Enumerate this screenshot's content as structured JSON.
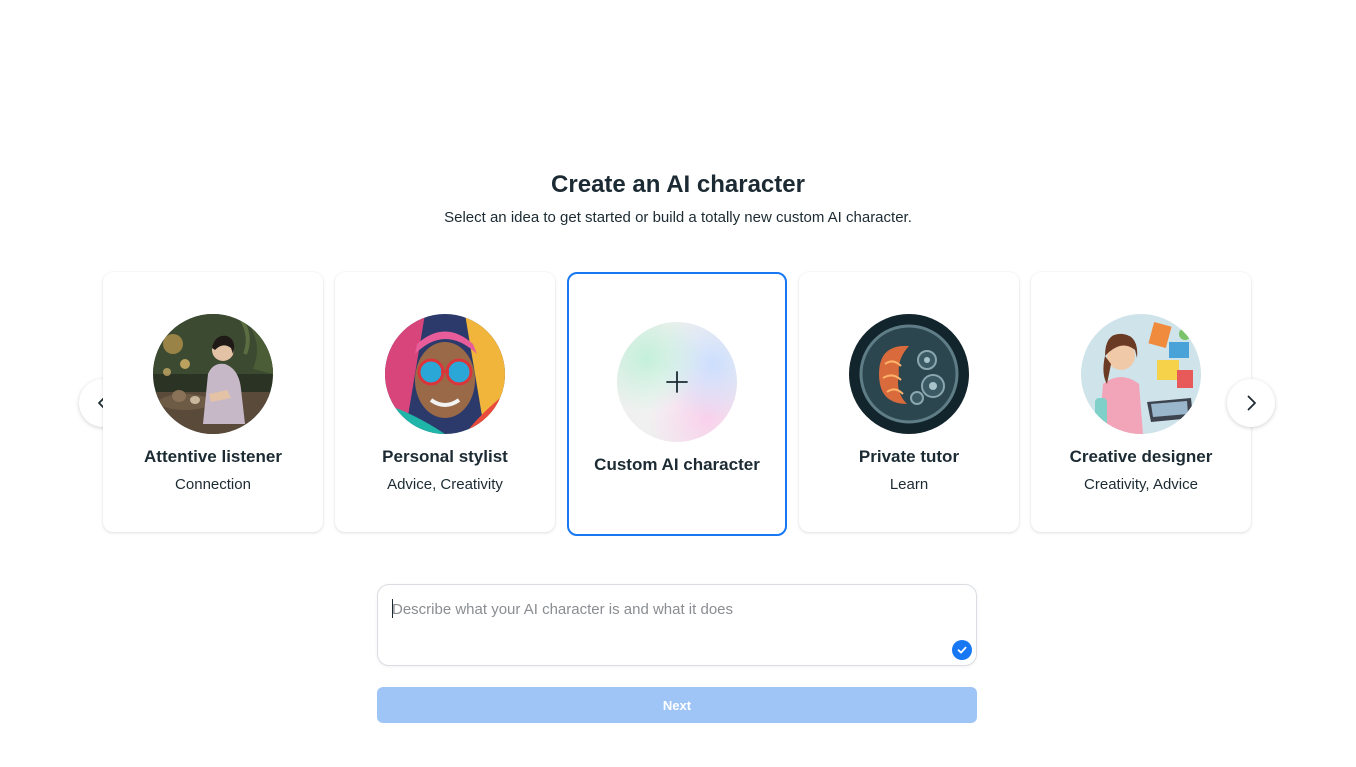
{
  "header": {
    "title": "Create an AI character",
    "subtitle": "Select an idea to get started or build a totally new custom AI character."
  },
  "cards": [
    {
      "name": "Attentive listener",
      "tags": "Connection"
    },
    {
      "name": "Personal stylist",
      "tags": "Advice, Creativity"
    },
    {
      "name": "Custom AI character",
      "tags": ""
    },
    {
      "name": "Private tutor",
      "tags": "Learn"
    },
    {
      "name": "Creative designer",
      "tags": "Creativity, Advice"
    }
  ],
  "carousel": {
    "prev_icon": "chevron-left-icon",
    "next_icon": "chevron-right-icon"
  },
  "prompt": {
    "placeholder": "Describe what your AI character is and what it does",
    "value": "",
    "status_icon": "checkmark-icon"
  },
  "next_button": {
    "label": "Next",
    "enabled": false
  },
  "colors": {
    "accent": "#1877f2",
    "disabled_button": "#9ec5f5",
    "text": "#1c2b33"
  }
}
